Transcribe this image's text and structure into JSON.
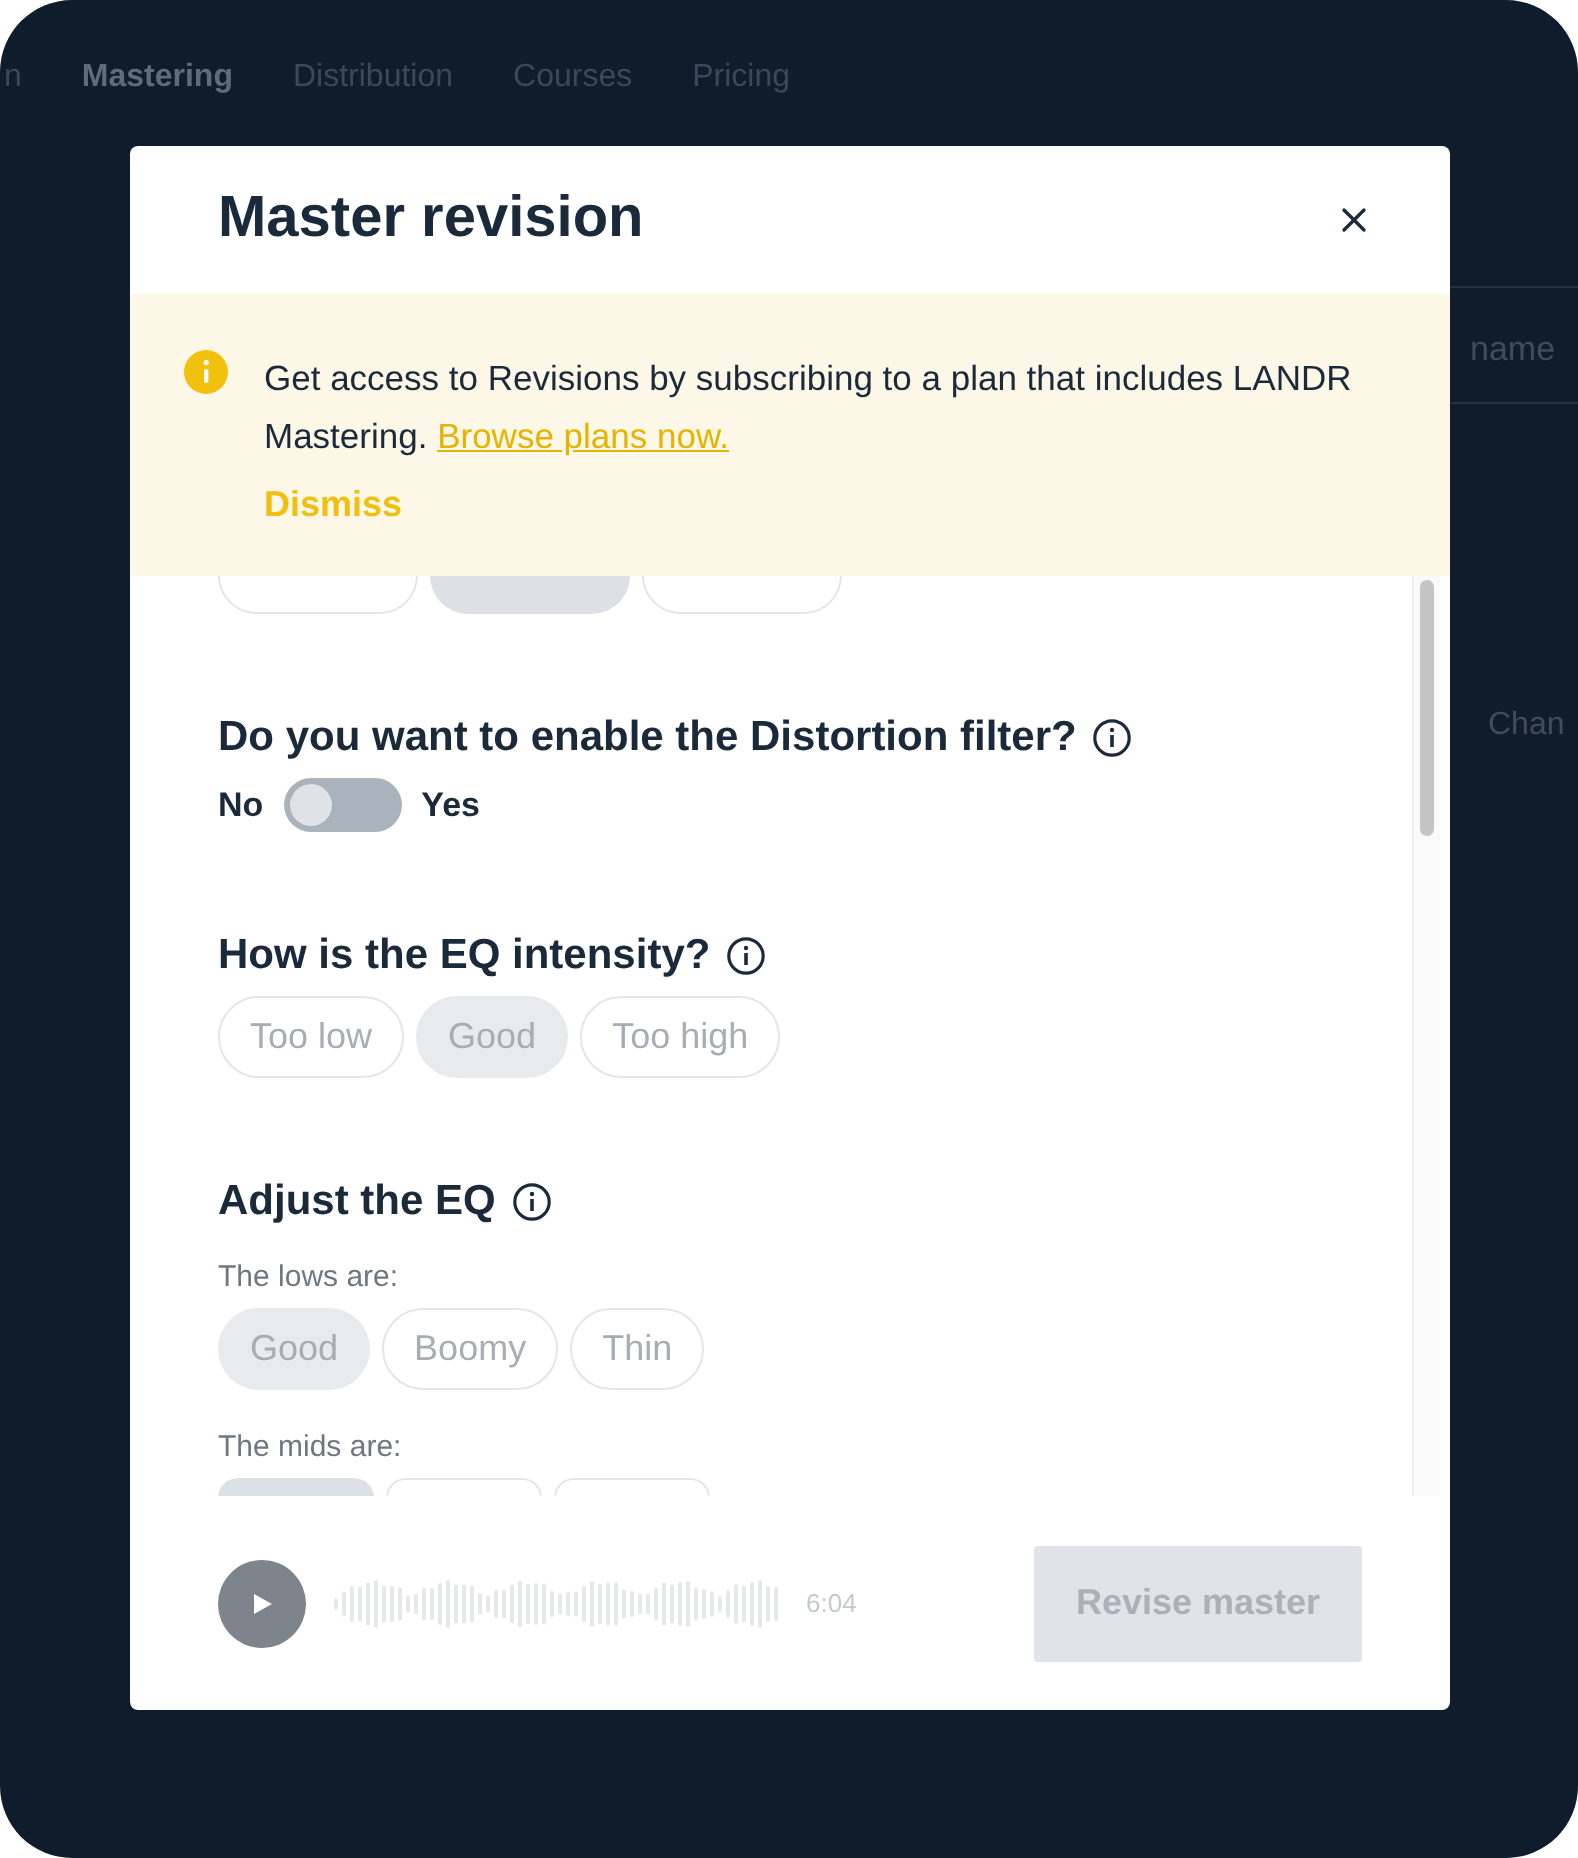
{
  "nav": [
    {
      "label": "n",
      "selected": false
    },
    {
      "label": "Mastering",
      "selected": true
    },
    {
      "label": "Distribution",
      "selected": false
    },
    {
      "label": "Courses",
      "selected": false
    },
    {
      "label": "Pricing",
      "selected": false
    }
  ],
  "background": {
    "field_hint": "name",
    "column_3": "Chan"
  },
  "modal": {
    "title": "Master revision",
    "banner": {
      "message": "Get access to Revisions by subscribing to a plan that includes LANDR Mastering.",
      "link": "Browse plans now.",
      "dismiss": "Dismiss"
    },
    "sections": [
      {
        "kind": "hidden-choice",
        "options": [
          {
            "selected": false
          },
          {
            "selected": true
          },
          {
            "selected": false
          }
        ]
      },
      {
        "kind": "toggle",
        "question": "Do you want to enable the Distortion filter?",
        "off_label": "No",
        "on_label": "Yes",
        "on": false
      },
      {
        "kind": "choice",
        "question": "How is the EQ intensity?",
        "options": [
          {
            "label": "Too low",
            "selected": false
          },
          {
            "label": "Good",
            "selected": true
          },
          {
            "label": "Too high",
            "selected": false
          }
        ]
      },
      {
        "kind": "eq",
        "title": "Adjust the EQ",
        "groups": [
          {
            "label": "The lows are:",
            "options": [
              {
                "label": "Good",
                "selected": true
              },
              {
                "label": "Boomy",
                "selected": false
              },
              {
                "label": "Thin",
                "selected": false
              }
            ]
          },
          {
            "label": "The mids are:",
            "options": [
              {
                "selected": true
              },
              {
                "selected": false
              },
              {
                "selected": false
              }
            ]
          }
        ]
      }
    ],
    "footer": {
      "time": "6:04",
      "action": {
        "label": "Revise master",
        "disabled": true
      }
    }
  }
}
